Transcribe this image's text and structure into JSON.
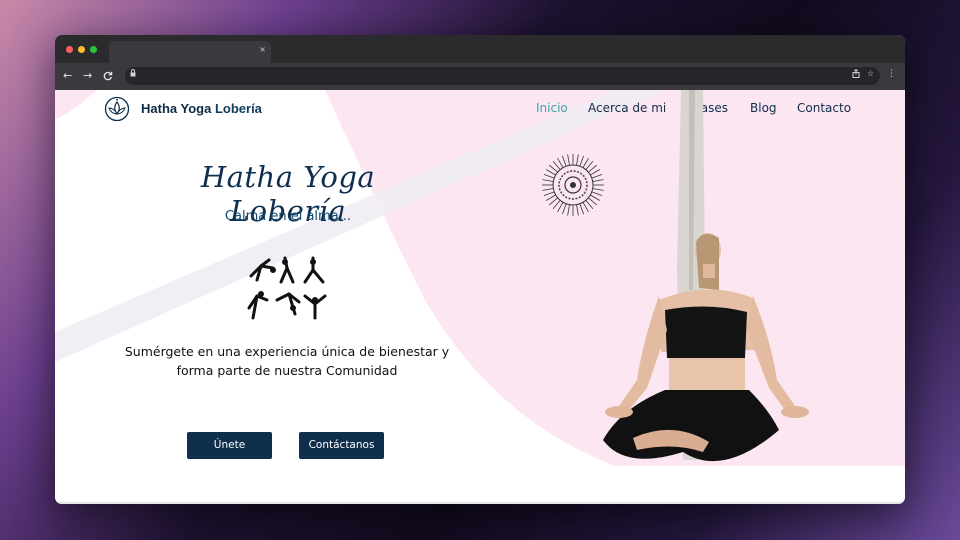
{
  "browser": {
    "tab_close": "×",
    "nav_back": "←",
    "nav_forward": "→",
    "nav_reload": "C",
    "lock_glyph": "🔒",
    "share_glyph": "⇪",
    "star_glyph": "☆",
    "menu_glyph": "⋮",
    "traffic_lights": [
      "#ff5f57",
      "#febc2e",
      "#28c840"
    ]
  },
  "site": {
    "brand_part1": "Hatha Yoga",
    "brand_part2": "Lobería",
    "nav": [
      {
        "label": "Inicio",
        "active": true
      },
      {
        "label": "Acerca de mi",
        "active": false
      },
      {
        "label": "Clases",
        "active": false
      },
      {
        "label": "Blog",
        "active": false
      },
      {
        "label": "Contacto",
        "active": false
      }
    ],
    "accent_color": "#3ea3a7",
    "primary_color": "#0f2f4d",
    "pink_bg": "#fbe6f2"
  },
  "hero": {
    "title": "Hatha Yoga Lobería",
    "subtitle": "Calma en el alma...",
    "description_line1": "Sumérgete en una experiencia única de bienestar y",
    "description_line2": "forma parte de nuestra Comunidad",
    "buttons": [
      {
        "label": "Únete"
      },
      {
        "label": "Contáctanos"
      }
    ]
  },
  "icons": {
    "logo": "lotus-icon",
    "mandala": "mandala-icon",
    "poses": "yoga-poses-icon"
  }
}
